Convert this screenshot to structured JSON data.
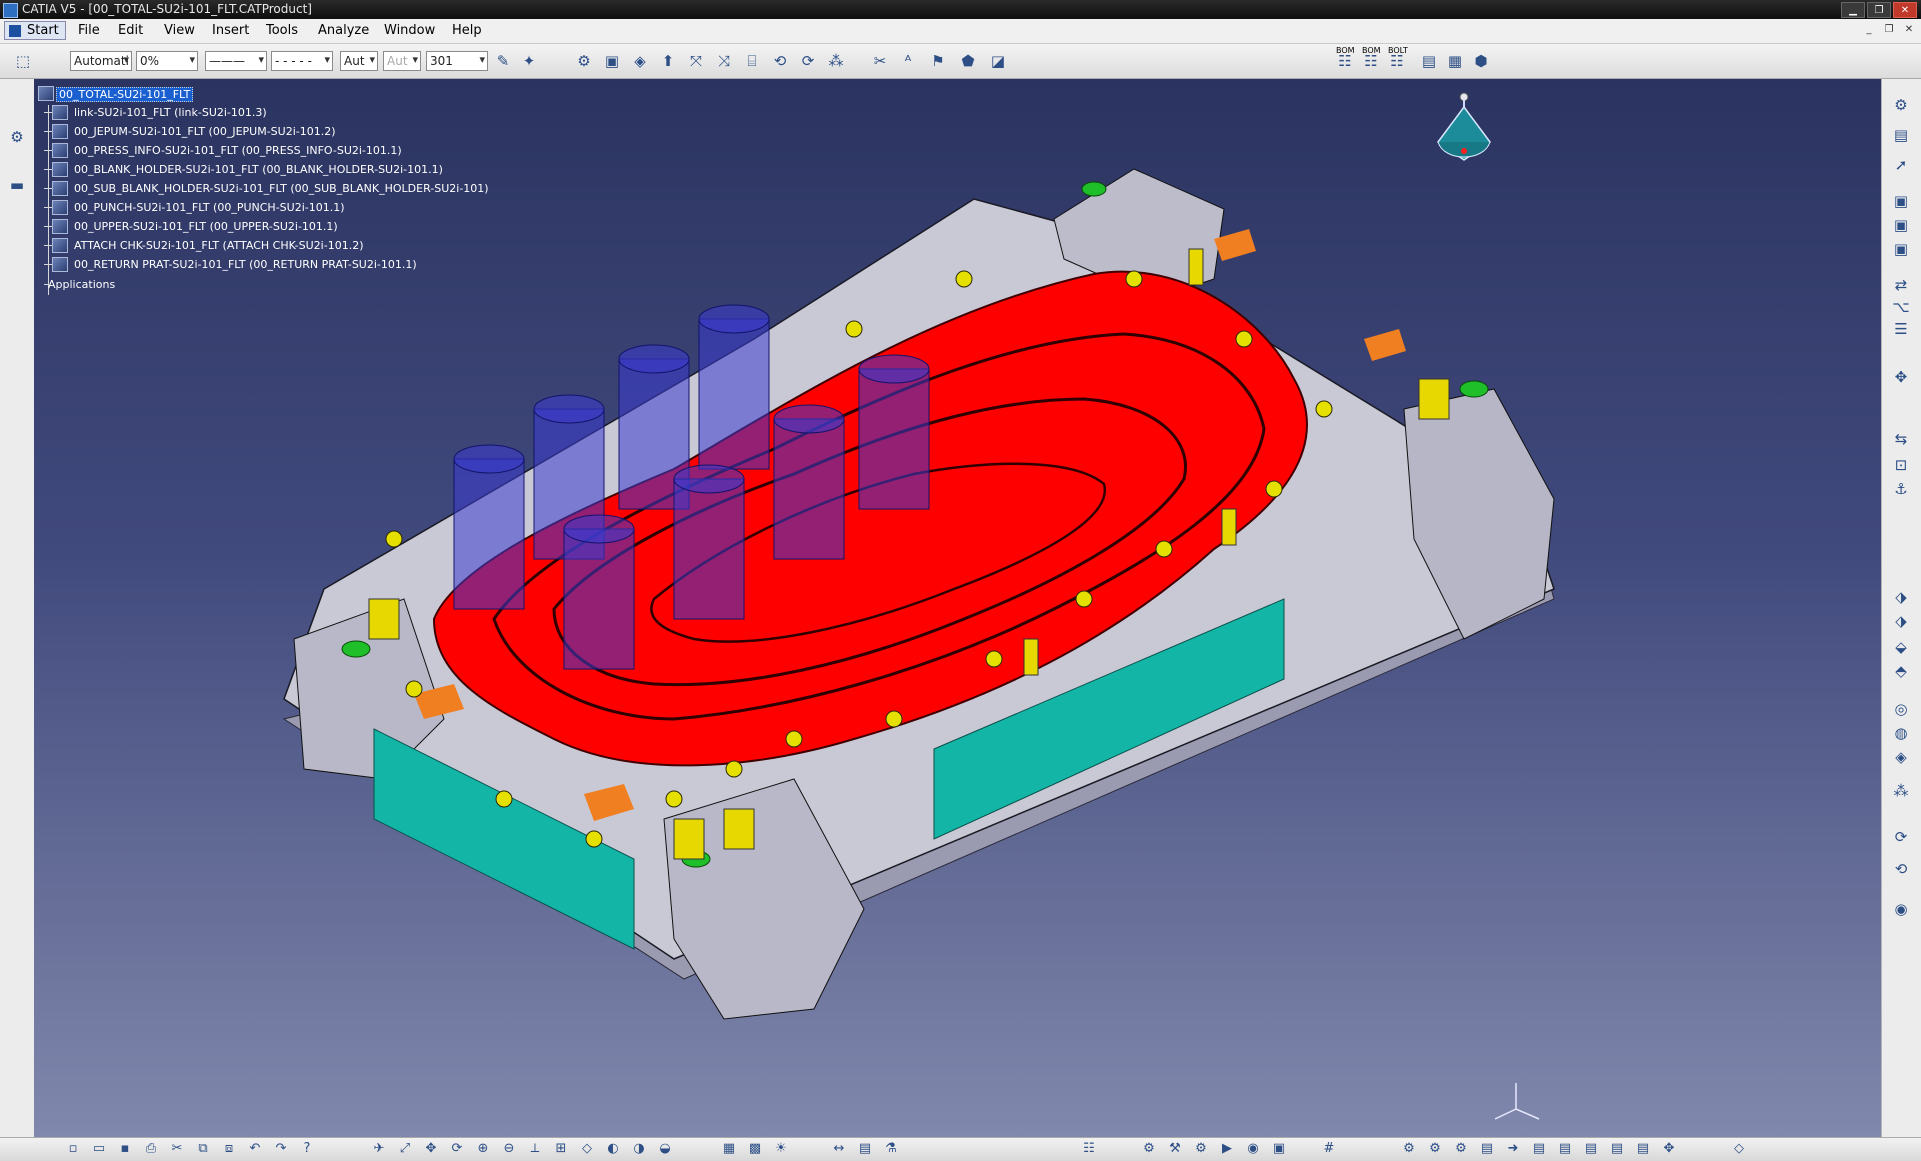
{
  "window": {
    "title": "CATIA V5 - [00_TOTAL-SU2i-101_FLT.CATProduct]"
  },
  "menu": [
    {
      "label": "Start"
    },
    {
      "label": "File"
    },
    {
      "label": "Edit"
    },
    {
      "label": "View"
    },
    {
      "label": "Insert"
    },
    {
      "label": "Tools"
    },
    {
      "label": "Analyze"
    },
    {
      "label": "Window"
    },
    {
      "label": "Help"
    }
  ],
  "toolbar": {
    "color_combo": "Automati",
    "transparency_combo": "0%",
    "line_thickness_combo": "———",
    "line_type_combo": "- - - - -",
    "layer_combo_1": "Aut",
    "layer_combo_2": "Aut",
    "layer_combo_3": "301",
    "bom_labels": [
      "BOM",
      "BOM",
      "BOLT"
    ]
  },
  "tree": {
    "root": "00_TOTAL-SU2i-101_FLT",
    "children": [
      "link-SU2i-101_FLT (link-SU2i-101.3)",
      "00_JEPUM-SU2i-101_FLT (00_JEPUM-SU2i-101.2)",
      "00_PRESS_INFO-SU2i-101_FLT (00_PRESS_INFO-SU2i-101.1)",
      "00_BLANK_HOLDER-SU2i-101_FLT (00_BLANK_HOLDER-SU2i-101.1)",
      "00_SUB_BLANK_HOLDER-SU2i-101_FLT (00_SUB_BLANK_HOLDER-SU2i-101)",
      "00_PUNCH-SU2i-101_FLT (00_PUNCH-SU2i-101.1)",
      "00_UPPER-SU2i-101_FLT (00_UPPER-SU2i-101.1)",
      "ATTACH CHK-SU2i-101_FLT (ATTACH CHK-SU2i-101.2)",
      "00_RETURN PRAT-SU2i-101_FLT (00_RETURN PRAT-SU2i-101.1)"
    ],
    "applications": "Applications"
  },
  "colors": {
    "part_red": "#ff0000",
    "die_grey": "#c9c9d6",
    "cylinder_blue": "#3a3ad0",
    "plate_teal": "#13b5a6",
    "background_top": "#2b3460",
    "background_bottom": "#8088ad"
  }
}
